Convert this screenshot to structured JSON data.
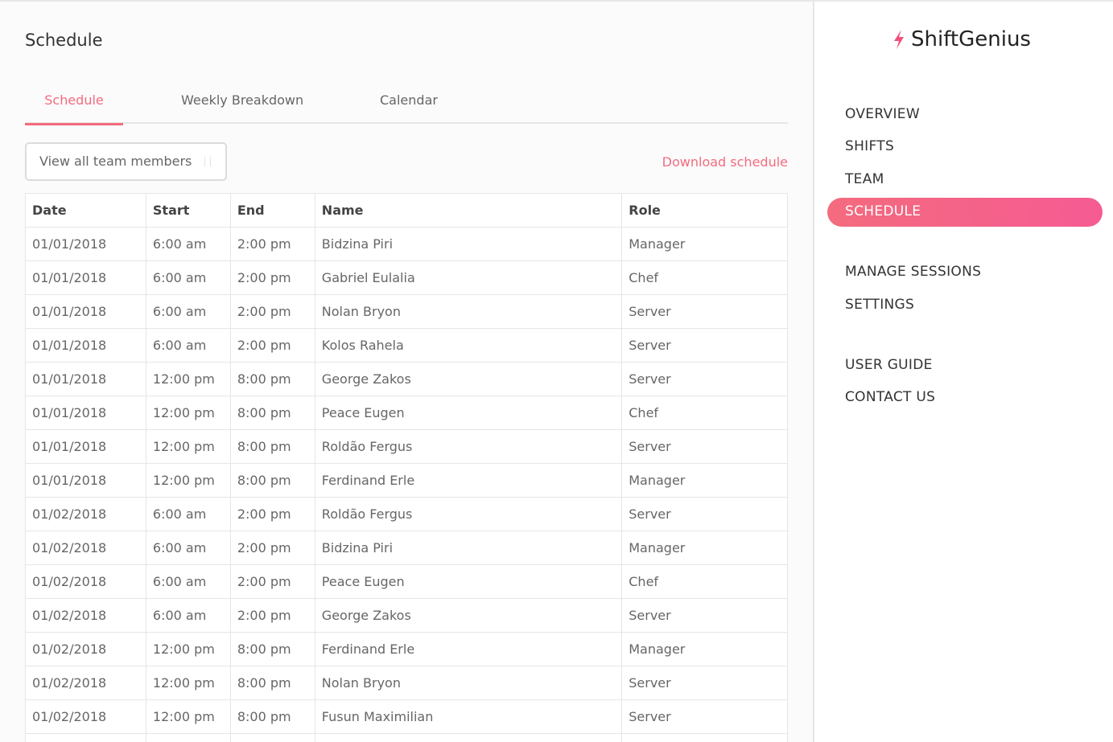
{
  "page": {
    "title": "Schedule"
  },
  "tabs": [
    {
      "label": "Schedule",
      "active": true
    },
    {
      "label": "Weekly Breakdown",
      "active": false
    },
    {
      "label": "Calendar",
      "active": false
    }
  ],
  "filter": {
    "value": "View all team members",
    "icon": "chevron-updown-icon"
  },
  "download": {
    "label": "Download schedule"
  },
  "table": {
    "headers": [
      "Date",
      "Start",
      "End",
      "Name",
      "Role"
    ],
    "rows": [
      [
        "01/01/2018",
        "6:00 am",
        "2:00 pm",
        "Bidzina Piri",
        "Manager"
      ],
      [
        "01/01/2018",
        "6:00 am",
        "2:00 pm",
        "Gabriel Eulalia",
        "Chef"
      ],
      [
        "01/01/2018",
        "6:00 am",
        "2:00 pm",
        "Nolan Bryon",
        "Server"
      ],
      [
        "01/01/2018",
        "6:00 am",
        "2:00 pm",
        "Kolos Rahela",
        "Server"
      ],
      [
        "01/01/2018",
        "12:00 pm",
        "8:00 pm",
        "George Zakos",
        "Server"
      ],
      [
        "01/01/2018",
        "12:00 pm",
        "8:00 pm",
        "Peace Eugen",
        "Chef"
      ],
      [
        "01/01/2018",
        "12:00 pm",
        "8:00 pm",
        "Roldão Fergus",
        "Server"
      ],
      [
        "01/01/2018",
        "12:00 pm",
        "8:00 pm",
        "Ferdinand Erle",
        "Manager"
      ],
      [
        "01/02/2018",
        "6:00 am",
        "2:00 pm",
        "Roldão Fergus",
        "Server"
      ],
      [
        "01/02/2018",
        "6:00 am",
        "2:00 pm",
        "Bidzina Piri",
        "Manager"
      ],
      [
        "01/02/2018",
        "6:00 am",
        "2:00 pm",
        "Peace Eugen",
        "Chef"
      ],
      [
        "01/02/2018",
        "6:00 am",
        "2:00 pm",
        "George Zakos",
        "Server"
      ],
      [
        "01/02/2018",
        "12:00 pm",
        "8:00 pm",
        "Ferdinand Erle",
        "Manager"
      ],
      [
        "01/02/2018",
        "12:00 pm",
        "8:00 pm",
        "Nolan Bryon",
        "Server"
      ],
      [
        "01/02/2018",
        "12:00 pm",
        "8:00 pm",
        "Fusun Maximilian",
        "Server"
      ],
      [
        "",
        "",
        "",
        "",
        ""
      ]
    ]
  },
  "sidebar": {
    "brand": "ShiftGenius",
    "brand_icon": "lightning-bolt-icon",
    "accent_color": "#f46b7e",
    "items": [
      {
        "label": "OVERVIEW",
        "active": false
      },
      {
        "label": "SHIFTS",
        "active": false
      },
      {
        "label": "TEAM",
        "active": false
      },
      {
        "label": "SCHEDULE",
        "active": true
      },
      {
        "label": "MANAGE SESSIONS",
        "active": false
      },
      {
        "label": "SETTINGS",
        "active": false
      },
      {
        "label": "USER GUIDE",
        "active": false
      },
      {
        "label": "CONTACT US",
        "active": false
      }
    ]
  }
}
